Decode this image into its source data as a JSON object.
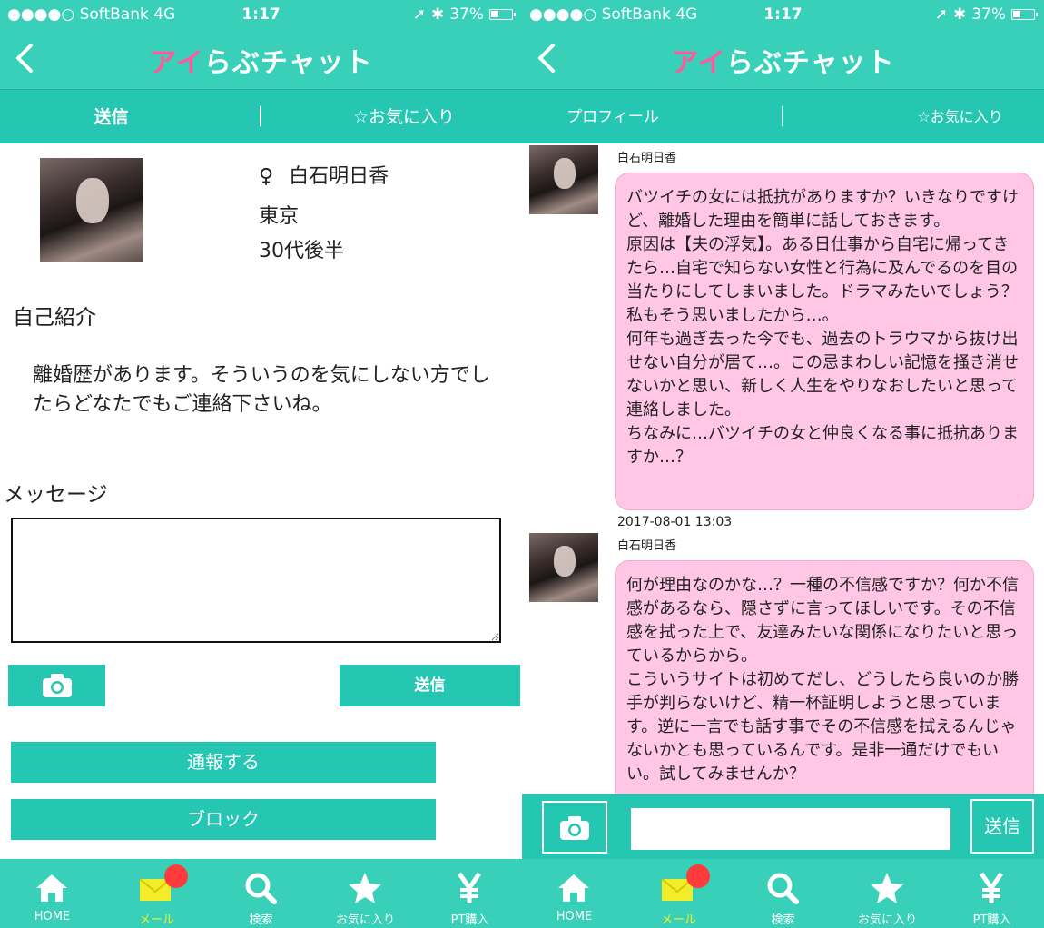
{
  "left": {
    "status": {
      "carrier": "●●●●○ SoftBank 4G",
      "time": "1:17",
      "battery": "37%"
    },
    "app_title": {
      "part1": "アイ",
      "part2": "らぶチャット"
    },
    "tabs": [
      {
        "label": "送信"
      },
      {
        "label": "☆お気に入り"
      }
    ],
    "profile": {
      "gender_symbol": "♀",
      "name": "白石明日香",
      "location": "東京",
      "age": "30代後半"
    },
    "intro": {
      "title": "自己紹介",
      "text": "離婚歴があります。そういうのを気にしない方でしたらどなたでもご連絡下さいね。"
    },
    "message": {
      "title": "メッセージ",
      "placeholder": ""
    },
    "buttons": {
      "send": "送信",
      "report": "通報する",
      "block": "ブロック"
    }
  },
  "right": {
    "status": {
      "carrier": "●●●●○ SoftBank 4G",
      "time": "1:17",
      "battery": "37%"
    },
    "app_title": {
      "part1": "アイ",
      "part2": "らぶチャット"
    },
    "tabs": [
      {
        "label": "プロフィール"
      },
      {
        "label": "☆お気に入り"
      }
    ],
    "messages": [
      {
        "sender": "白石明日香",
        "text": "バツイチの女には抵抗がありますか？いきなりですけど、離婚した理由を簡単に話しておきます。\n原因は【夫の浮気】。ある日仕事から自宅に帰ってきたら…自宅で知らない女性と行為に及んでるのを目の当たりにしてしまいました。ドラマみたいでしょう？私もそう思いましたから…。\n何年も過ぎ去った今でも、過去のトラウマから抜け出せない自分が居て…。この忌まわしい記憶を掻き消せないかと思い、新しく人生をやりなおしたいと思って連絡しました。\nちなみに…バツイチの女と仲良くなる事に抵抗ありますか…？"
      },
      {
        "timestamp": "2017-08-01 13:03",
        "sender": "白石明日香",
        "text": "何が理由なのかな…？一種の不信感ですか？何か不信感があるなら、隠さずに言ってほしいです。その不信感を拭った上で、友達みたいな関係になりたいと思っているからから。\nこういうサイトは初めてだし、どうしたら良いのか勝手が判らないけど、精一杯証明しようと思っています。逆に一言でも話す事でその不信感を拭えるんじゃないかとも思っているんです。是非一通だけでもいい。試してみませんか？"
      }
    ],
    "input": {
      "placeholder": "",
      "send": "送信"
    }
  },
  "bottom_nav": [
    {
      "label": "HOME",
      "icon": "home-icon"
    },
    {
      "label": "メール",
      "icon": "mail-icon"
    },
    {
      "label": "検索",
      "icon": "search-icon"
    },
    {
      "label": "お気に入り",
      "icon": "star-icon"
    },
    {
      "label": "PT購入",
      "icon": "yen-icon"
    }
  ],
  "colors": {
    "header": "#38d0b8",
    "tabbar": "#26c7b2",
    "bubble": "#ffc7e5",
    "badge": "#ff3b3b",
    "active_label": "#f2ec2a",
    "logo_pink": "#ff5a9e"
  }
}
